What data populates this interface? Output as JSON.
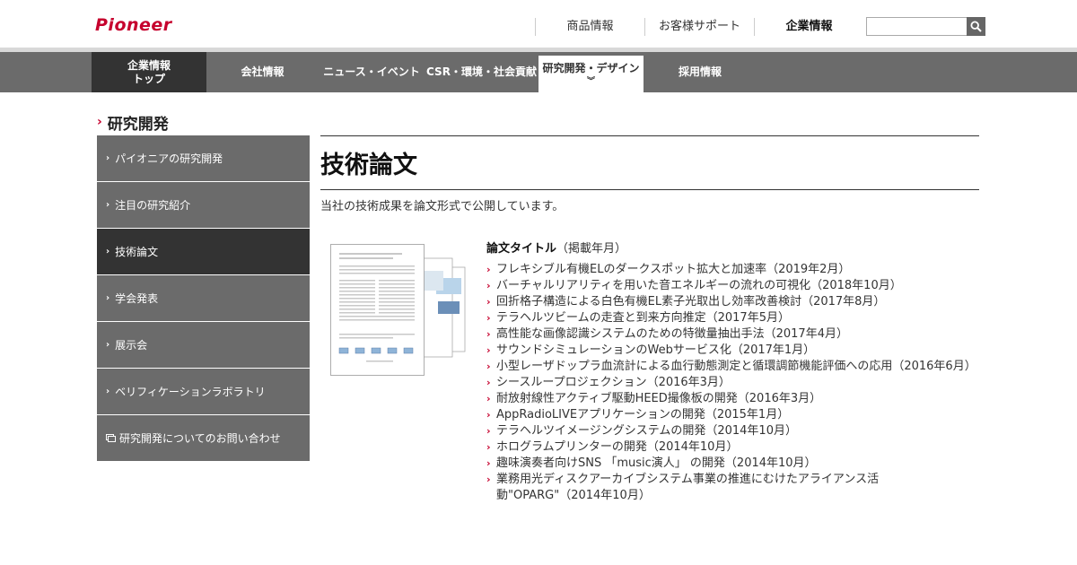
{
  "header": {
    "logo_text": "Pioneer",
    "brand_color": "#c6002d",
    "topnav": [
      "商品情報",
      "お客様サポート",
      "企業情報"
    ],
    "search": {
      "placeholder": "",
      "button_icon": "search-icon"
    }
  },
  "gnav": {
    "top_line1": "企業情報",
    "top_line2": "トップ",
    "items": [
      "会社情報",
      "ニュース・イベント",
      "CSR・環境・社会貢献",
      "研究開発・デザイン",
      "採用情報"
    ],
    "active_index": 3
  },
  "section": {
    "title": "研究開発"
  },
  "sidemenu": {
    "items": [
      "パイオニアの研究開発",
      "注目の研究紹介",
      "技術論文",
      "学会発表",
      "展示会",
      "ベリフィケーションラボラトリ",
      "研究開発についてのお問い合わせ"
    ],
    "active_index": 2
  },
  "main": {
    "title": "技術論文",
    "lead": "当社の技術成果を論文形式で公開しています。",
    "list_head_bold": "論文タイトル",
    "list_head_rest": "（掲載年月）",
    "papers": [
      "フレキシブル有機ELのダークスポット拡大と加速率（2019年2月）",
      "バーチャルリアリティを用いた音エネルギーの流れの可視化（2018年10月）",
      "回折格子構造による白色有機EL素子光取出し効率改善検討（2017年8月）",
      "テラヘルツビームの走査と到来方向推定（2017年5月）",
      "高性能な画像認識システムのための特徴量抽出手法（2017年4月）",
      "サウンドシミュレーションのWebサービス化（2017年1月）",
      "小型レーザドップラ血流計による血行動態測定と循環調節機能評価への応用（2016年6月）",
      "シースループロジェクション（2016年3月）",
      "耐放射線性アクティブ駆動HEED撮像板の開発（2016年3月）",
      "AppRadioLIVEアプリケーションの開発（2015年1月）",
      "テラヘルツイメージングシステムの開発（2014年10月）",
      "ホログラムプリンターの開発（2014年10月）",
      "趣味演奏者向けSNS 「music演人」 の開発（2014年10月）",
      "業務用光ディスクアーカイブシステム事業の推進にむけたアライアンス活動\"OPARG\"（2014年10月）"
    ]
  }
}
